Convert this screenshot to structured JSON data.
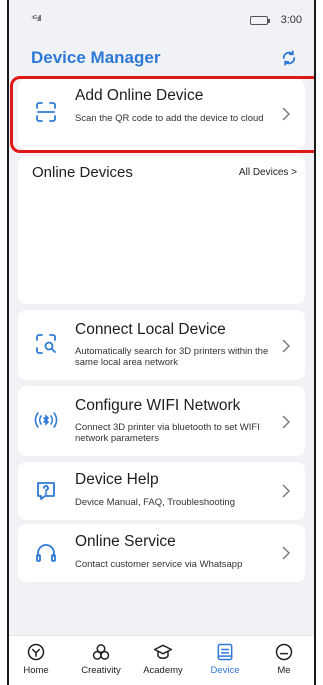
{
  "status_bar": {
    "signal": "⁴ᴳ.ıll",
    "time": "3:00"
  },
  "header": {
    "title": "Device Manager"
  },
  "add_device": {
    "title": "Add Online Device",
    "desc": "Scan the QR code to add the device to cloud"
  },
  "online_devices": {
    "title": "Online Devices",
    "all_link": "All Devices >"
  },
  "menu": [
    {
      "title": "Connect Local Device",
      "desc": "Automatically search for 3D printers within the same local area network",
      "icon": "search-scan-icon"
    },
    {
      "title": "Configure WIFI Network",
      "desc": "Connect 3D printer via bluetooth to set WIFI network parameters",
      "icon": "wifi-bluetooth-icon"
    },
    {
      "title": "Device Help",
      "desc": "Device Manual, FAQ, Troubleshooting",
      "icon": "question-chat-icon"
    },
    {
      "title": "Online Service",
      "desc": "Contact customer service via Whatsapp",
      "icon": "headset-icon"
    }
  ],
  "tabs": [
    {
      "label": "Home",
      "icon": "home-icon"
    },
    {
      "label": "Creativity",
      "icon": "creativity-icon"
    },
    {
      "label": "Academy",
      "icon": "academy-icon"
    },
    {
      "label": "Device",
      "icon": "device-icon",
      "active": true
    },
    {
      "label": "Me",
      "icon": "me-icon"
    }
  ],
  "colors": {
    "accent": "#2e79d6",
    "highlight": "#e01818",
    "background": "#f1f2f5"
  }
}
